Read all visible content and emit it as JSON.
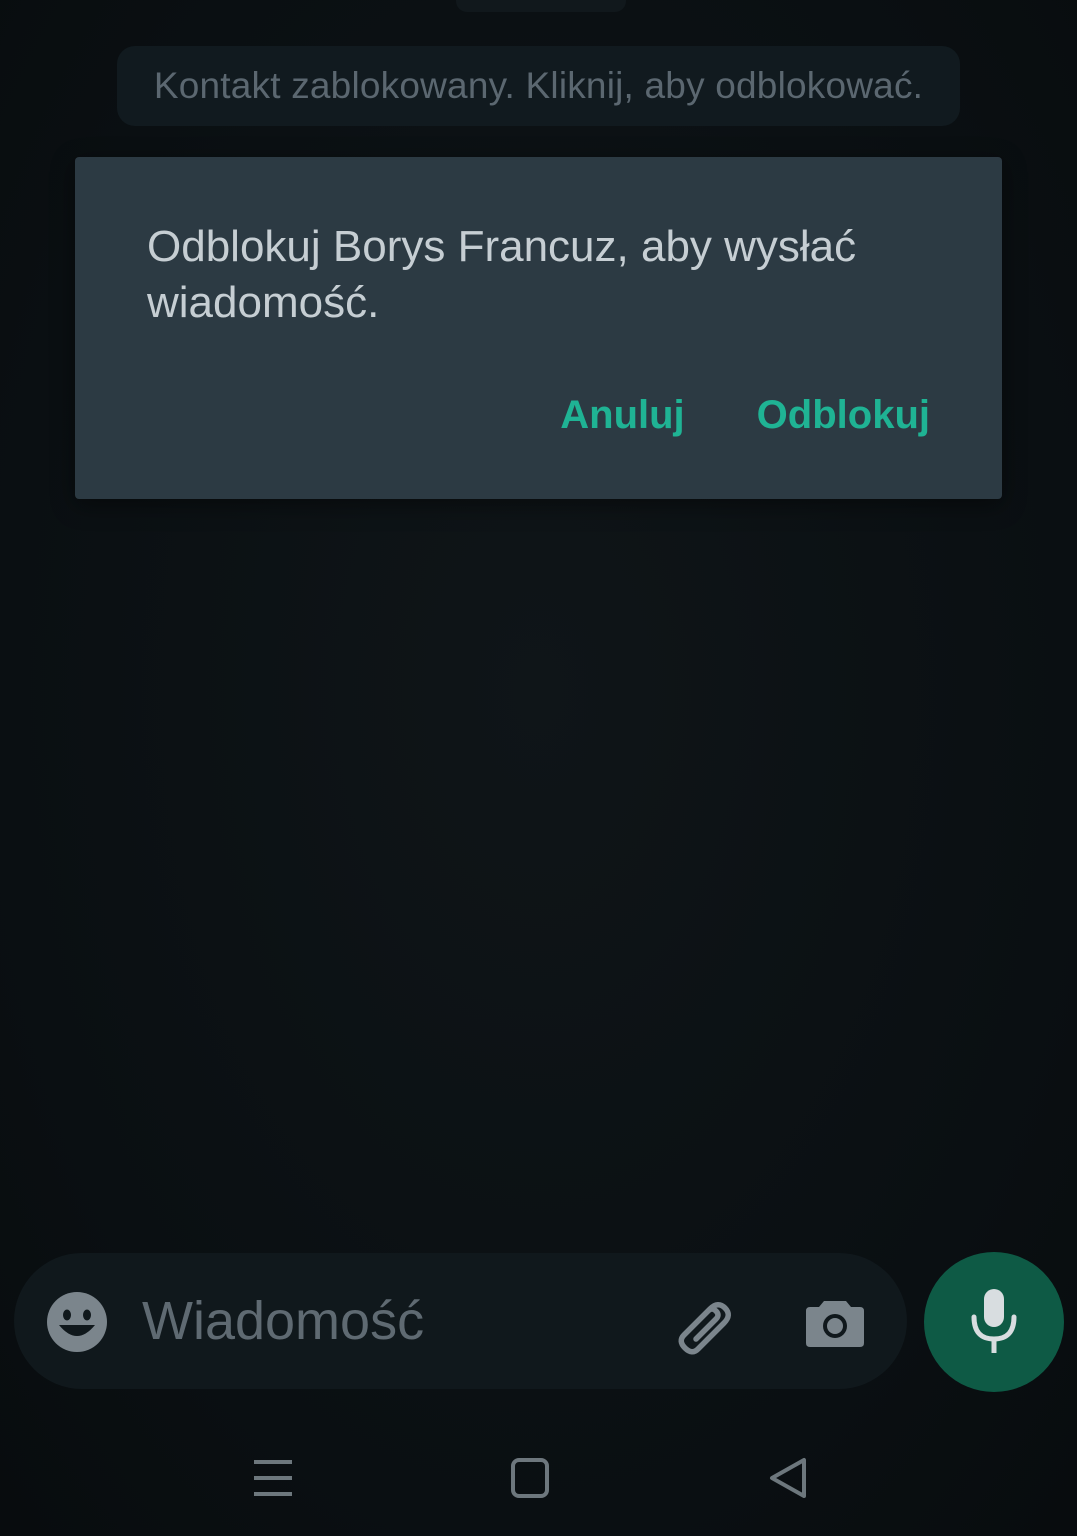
{
  "banner": {
    "text": "Kontakt zablokowany. Kliknij, aby odblokować."
  },
  "dialog": {
    "message": "Odblokuj Borys Francuz, aby wysłać wiadomość.",
    "cancel_label": "Anuluj",
    "confirm_label": "Odblokuj"
  },
  "composer": {
    "placeholder": "Wiadomość",
    "icons": {
      "emoji": "emoji-icon",
      "attach": "paperclip-icon",
      "camera": "camera-icon",
      "mic": "microphone-icon"
    }
  },
  "navbar": {
    "icons": [
      "menu-icon",
      "home-square-icon",
      "back-triangle-icon"
    ]
  },
  "colors": {
    "accent": "#1fb394",
    "dialog_bg": "#2c3a43",
    "mic_bg": "#0e5a45"
  }
}
